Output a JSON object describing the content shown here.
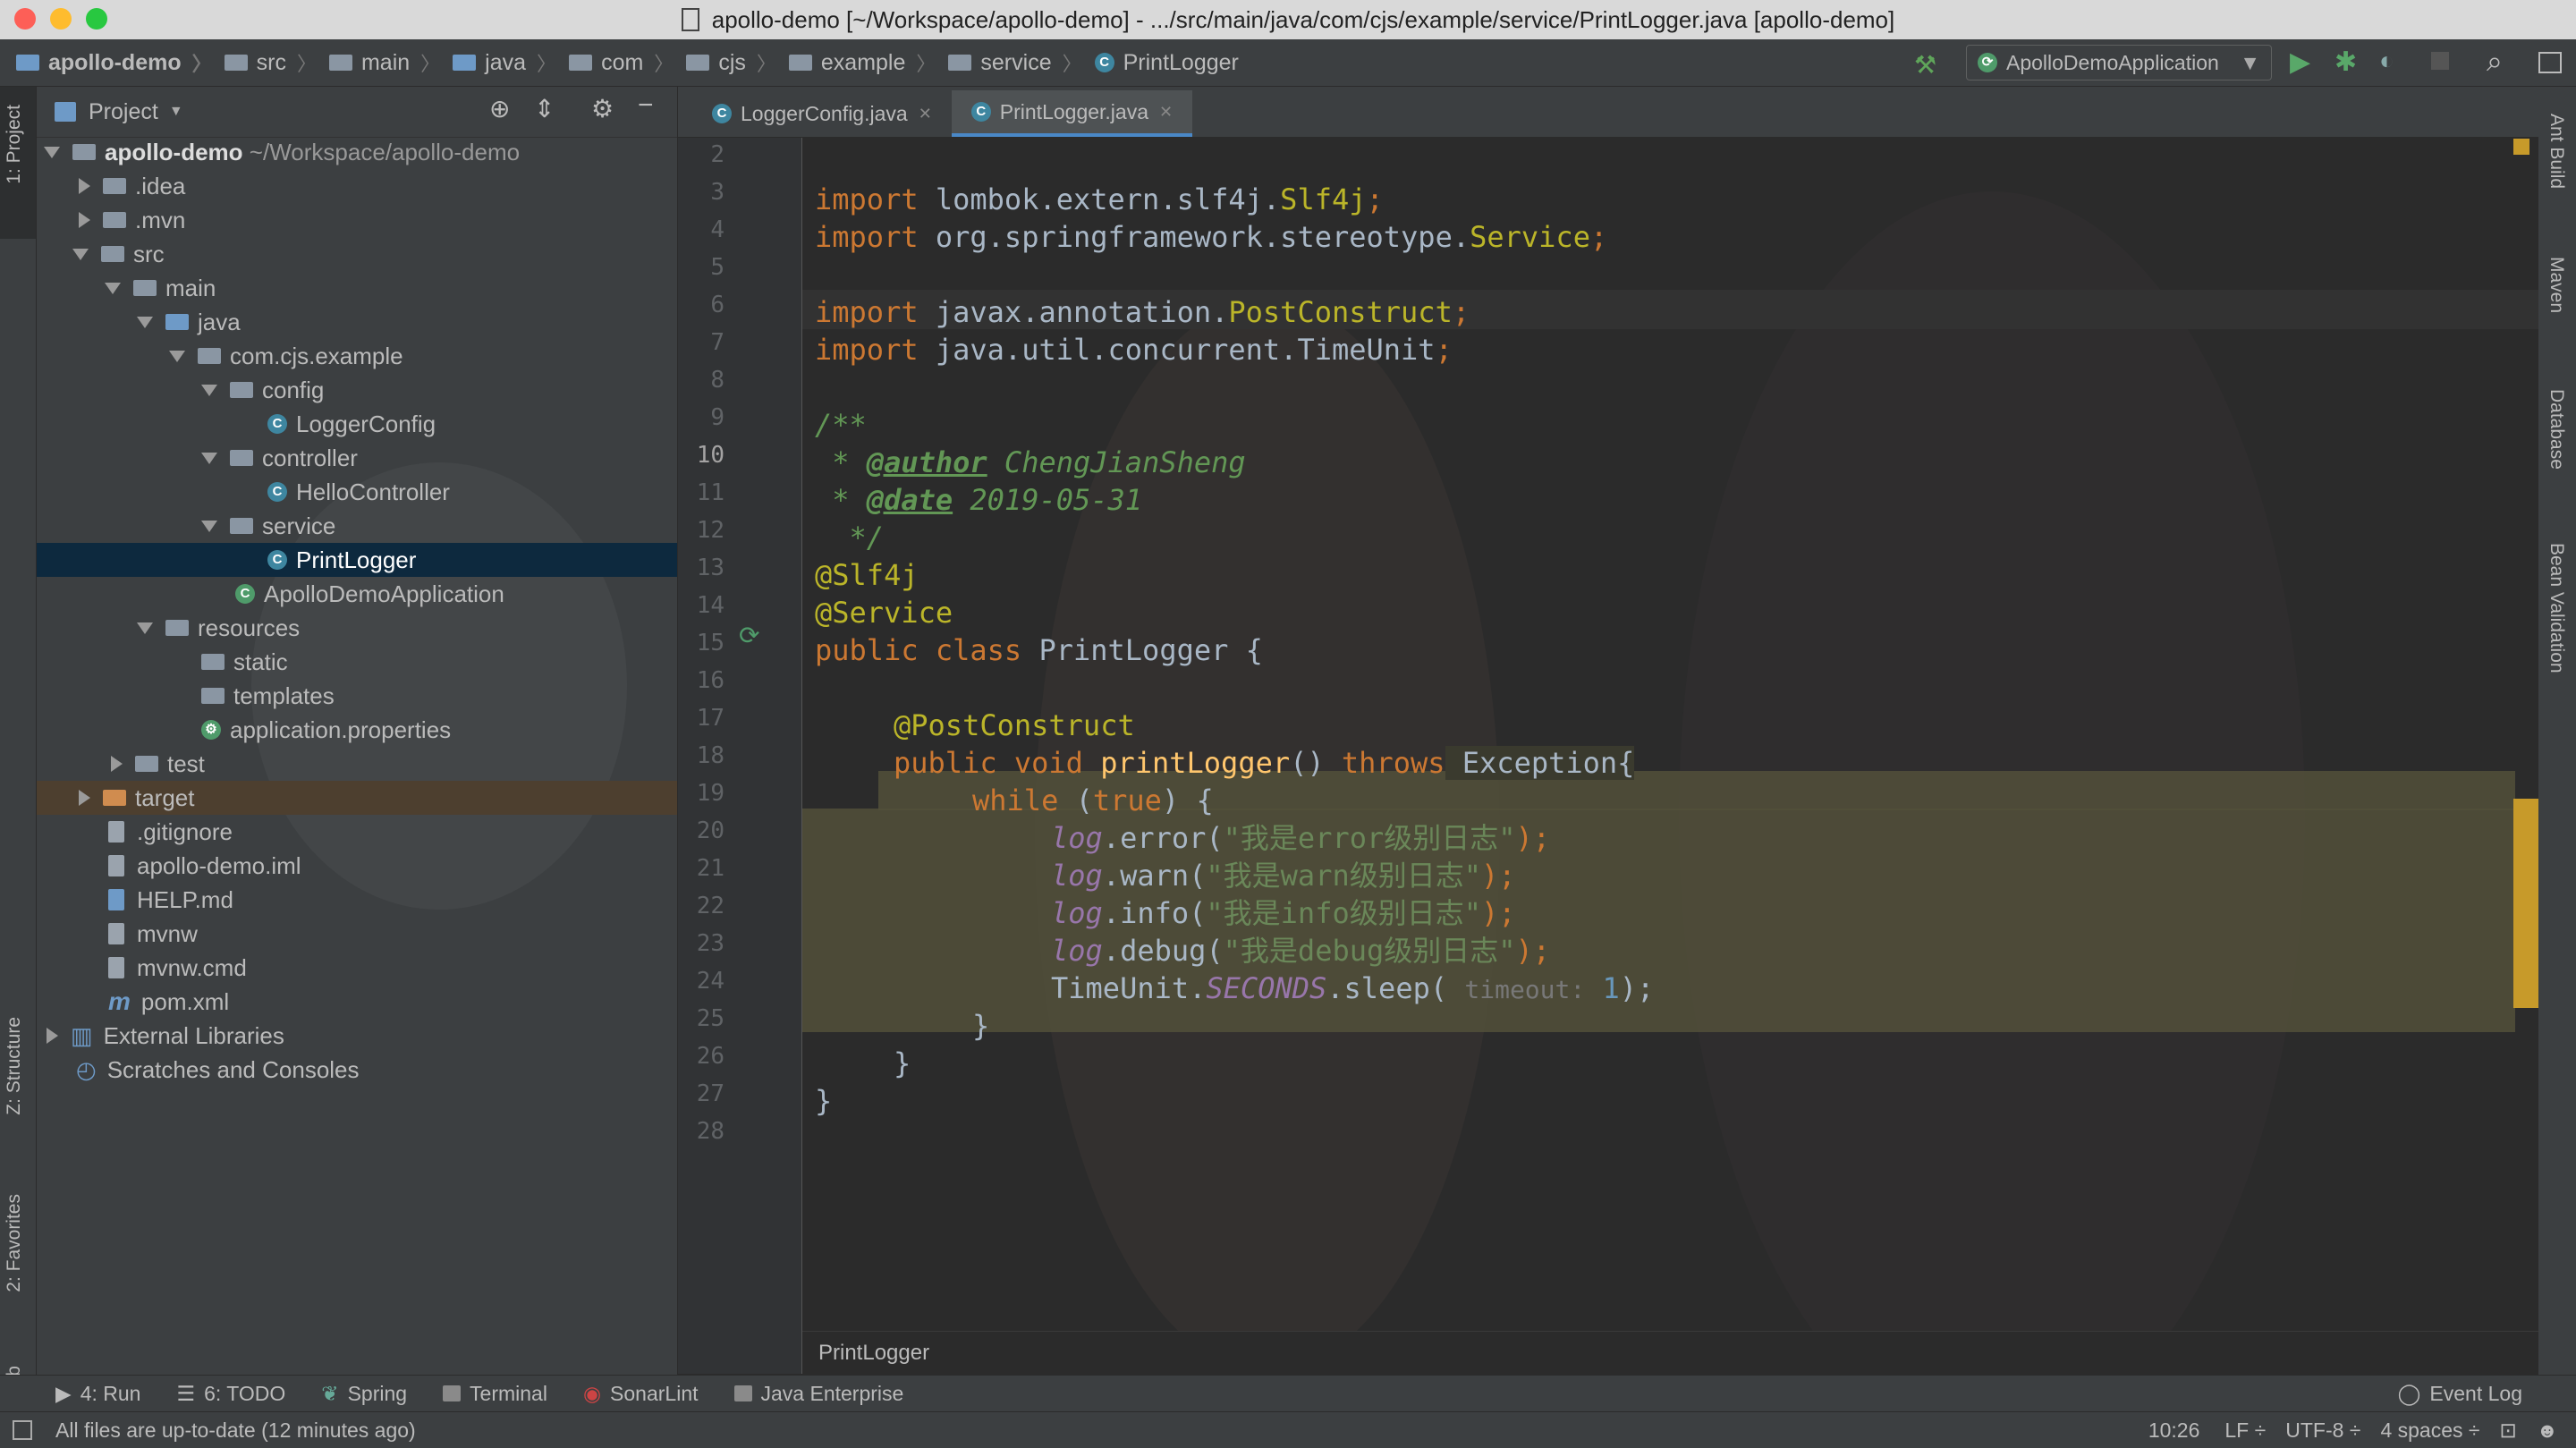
{
  "window": {
    "title": "apollo-demo [~/Workspace/apollo-demo] - .../src/main/java/com/cjs/example/service/PrintLogger.java [apollo-demo]"
  },
  "breadcrumb": [
    "apollo-demo",
    "src",
    "main",
    "java",
    "com",
    "cjs",
    "example",
    "service",
    "PrintLogger"
  ],
  "toolbar": {
    "run_config": "ApolloDemoApplication"
  },
  "left_strip": {
    "project_tab": "1: Project",
    "structure_tab": "Z: Structure",
    "favorites_tab": "2: Favorites",
    "web_tab": "Web"
  },
  "right_strip": {
    "ant": "Ant Build",
    "maven": "Maven",
    "database": "Database",
    "bean": "Bean Validation"
  },
  "project": {
    "header": "Project",
    "root_name": "apollo-demo",
    "root_path": "~/Workspace/apollo-demo",
    "items": [
      ".idea",
      ".mvn",
      "src",
      "main",
      "java",
      "com.cjs.example",
      "config",
      "LoggerConfig",
      "controller",
      "HelloController",
      "service",
      "PrintLogger",
      "ApolloDemoApplication",
      "resources",
      "static",
      "templates",
      "application.properties",
      "test",
      "target",
      ".gitignore",
      "apollo-demo.iml",
      "HELP.md",
      "mvnw",
      "mvnw.cmd",
      "pom.xml",
      "External Libraries",
      "Scratches and Consoles"
    ]
  },
  "editor": {
    "tabs": [
      {
        "label": "LoggerConfig.java"
      },
      {
        "label": "PrintLogger.java"
      }
    ],
    "line_numbers": [
      "2",
      "3",
      "4",
      "5",
      "6",
      "7",
      "8",
      "9",
      "10",
      "11",
      "12",
      "13",
      "14",
      "15",
      "16",
      "17",
      "18",
      "19",
      "20",
      "21",
      "22",
      "23",
      "24",
      "25",
      "26",
      "27",
      "28"
    ],
    "code": {
      "l3": [
        "import",
        " lombok.extern.slf4j.",
        "Slf4j",
        ";"
      ],
      "l4": [
        "import",
        " org.springframework.stereotype.",
        "Service",
        ";"
      ],
      "l6": [
        "import",
        " javax.annotation.",
        "PostConstruct",
        ";"
      ],
      "l7": [
        "import",
        " java.util.concurrent.TimeUnit",
        ";"
      ],
      "l9": "/**",
      "l10": [
        " * ",
        "@author",
        " ChengJianSheng"
      ],
      "l11": [
        " * ",
        "@date",
        " 2019-05-31"
      ],
      "l12": "  */",
      "l13": "@Slf4j",
      "l14": "@Service",
      "l15": [
        "public class",
        " PrintLogger {"
      ],
      "l17": "@PostConstruct",
      "l18": [
        "public void",
        " printLogger",
        "() ",
        "throws",
        " Exception{"
      ],
      "l19": [
        "while",
        " (",
        "true",
        ") {"
      ],
      "l20": [
        "log",
        ".error(",
        "\"我是error级别日志\"",
        ");"
      ],
      "l21": [
        "log",
        ".warn(",
        "\"我是warn级别日志\"",
        ");"
      ],
      "l22": [
        "log",
        ".info(",
        "\"我是info级别日志\"",
        ");"
      ],
      "l23": [
        "log",
        ".debug(",
        "\"我是debug级别日志\"",
        ");"
      ],
      "l24": [
        "TimeUnit.",
        "SECONDS",
        ".sleep( ",
        "timeout:",
        " 1",
        ");"
      ],
      "l25": "}",
      "l26": "}",
      "l27": "}"
    },
    "breadcrumb_footer": "PrintLogger"
  },
  "tool_windows": [
    "4: Run",
    "6: TODO",
    "Spring",
    "Terminal",
    "SonarLint",
    "Java Enterprise",
    "Event Log"
  ],
  "status": {
    "message": "All files are up-to-date (12 minutes ago)",
    "position": "10:26",
    "line_sep": "LF ÷",
    "encoding": "UTF-8 ÷",
    "indent": "4 spaces ÷"
  },
  "colors": {
    "accent": "#4a88c7",
    "selection": "#0d293e",
    "highlight": "#52503a"
  }
}
